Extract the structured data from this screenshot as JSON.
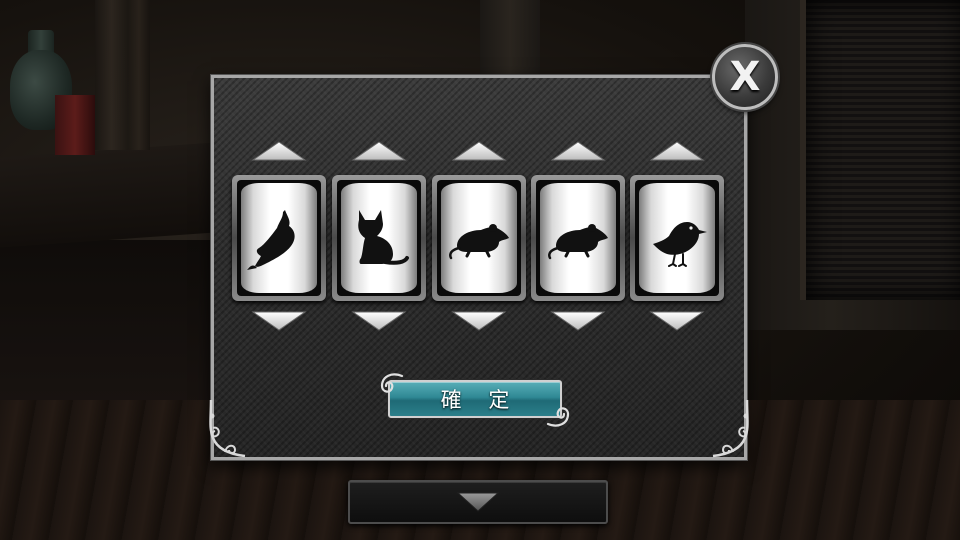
{
  "close_button": {
    "glyph": "X",
    "icon": "close-icon"
  },
  "reels": [
    {
      "symbol": "fish",
      "icon": "fish-icon"
    },
    {
      "symbol": "cat",
      "icon": "cat-icon"
    },
    {
      "symbol": "rat",
      "icon": "rat-icon"
    },
    {
      "symbol": "rat",
      "icon": "rat-icon"
    },
    {
      "symbol": "bird",
      "icon": "bird-icon"
    }
  ],
  "confirm_button": {
    "label": "確 定"
  },
  "inventory_toggle": {
    "icon": "chevron-down-icon"
  },
  "colors": {
    "panel_border": "#a7a7a7",
    "confirm_teal": "#2f8894",
    "arrow_white": "#f0f0f0"
  }
}
